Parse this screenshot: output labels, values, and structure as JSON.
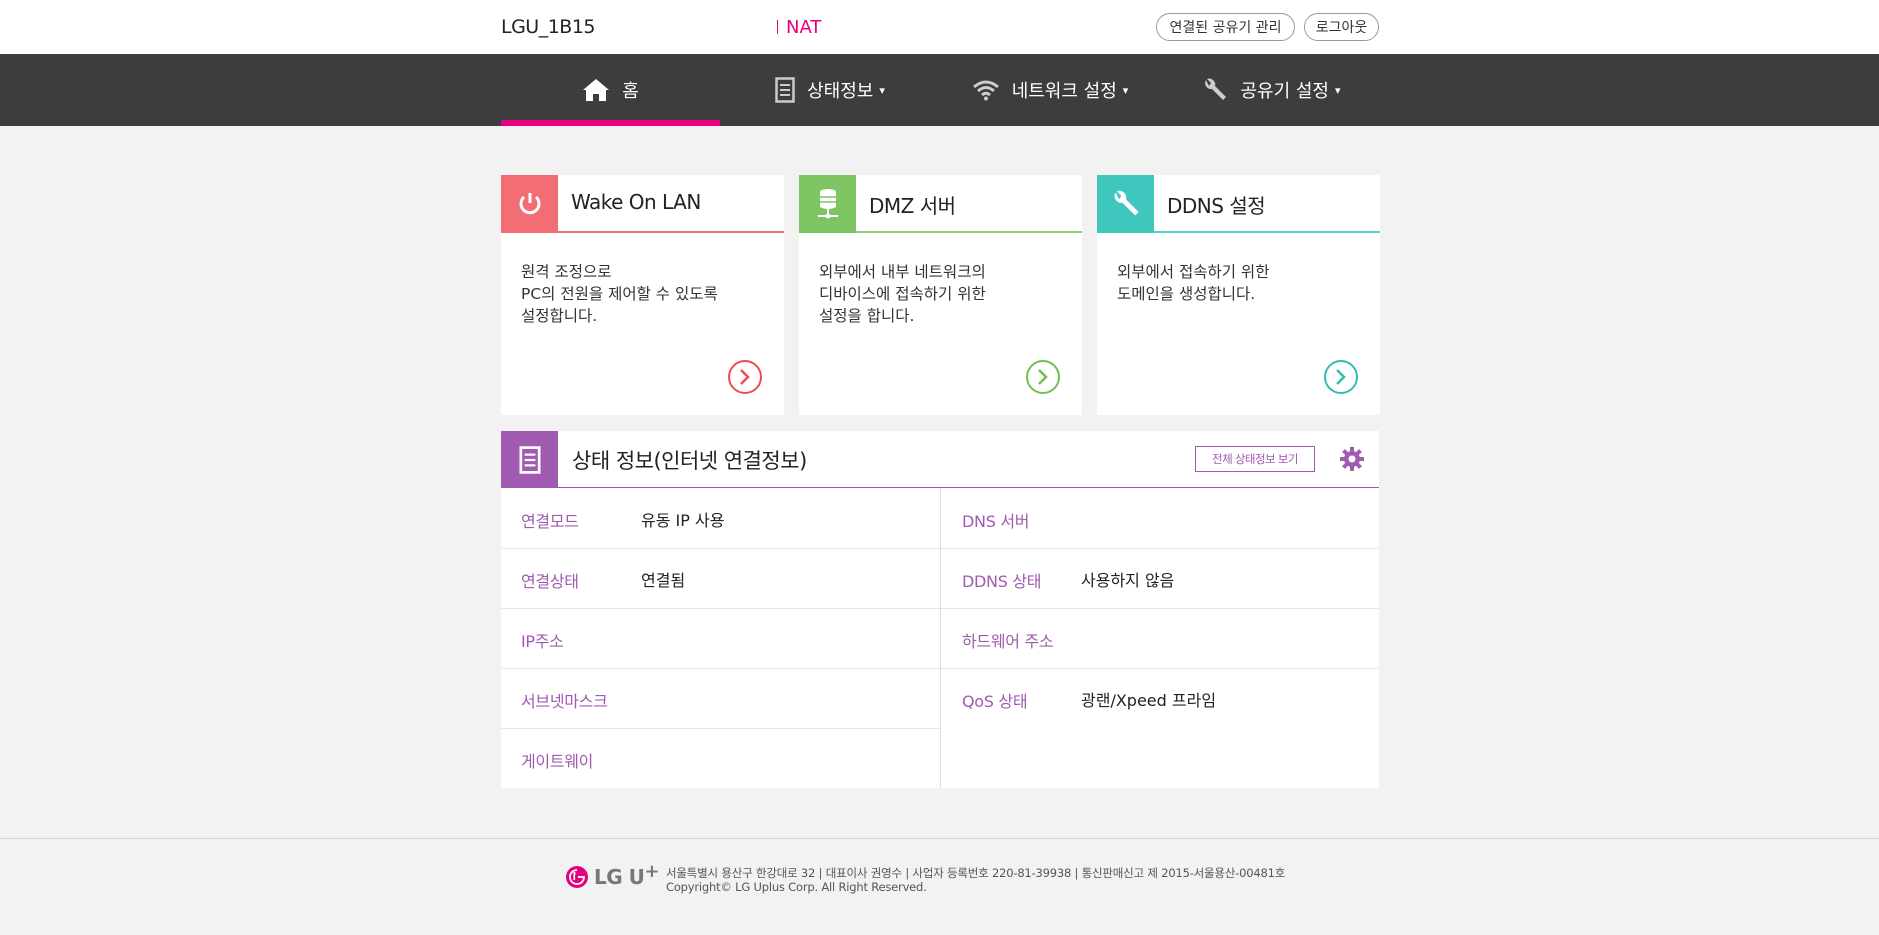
{
  "header": {
    "model": "LGU_1B15",
    "mode": "NAT",
    "manage_button": "연결된 공유기 관리",
    "logout_button": "로그아웃"
  },
  "nav": {
    "home": "홈",
    "status": "상태정보",
    "network": "네트워크 설정",
    "router": "공유기 설정",
    "caret": "▾"
  },
  "cards": [
    {
      "title": "Wake On LAN",
      "desc": [
        "원격 조정으로",
        "PC의 전원을 제어할 수 있도록",
        "설정합니다."
      ],
      "color": "#f26e74"
    },
    {
      "title": "DMZ 서버",
      "desc": [
        "외부에서 내부 네트워크의",
        "디바이스에 접속하기 위한",
        "설정을 합니다."
      ],
      "color": "#7dc462"
    },
    {
      "title": "DDNS 설정",
      "desc": [
        "외부에서 접속하기 위한",
        "도메인을 생성합니다."
      ],
      "color": "#3fc7bd"
    }
  ],
  "status": {
    "title": "상태 정보(인터넷 연결정보)",
    "view_all_button": "전체 상태정보 보기",
    "left": [
      {
        "label": "연결모드",
        "value": "유동 IP 사용"
      },
      {
        "label": "연결상태",
        "value": "연결됨"
      },
      {
        "label": "IP주소",
        "value": ""
      },
      {
        "label": "서브넷마스크",
        "value": ""
      },
      {
        "label": "게이트웨이",
        "value": ""
      }
    ],
    "right": [
      {
        "label": "DNS 서버",
        "value": ""
      },
      {
        "label": "DDNS 상태",
        "value": "사용하지 않음"
      },
      {
        "label": "하드웨어 주소",
        "value": ""
      },
      {
        "label": "QoS 상태",
        "value": "광랜/Xpeed 프라임"
      }
    ]
  },
  "footer": {
    "logo_text": "LG U",
    "logo_plus": "+",
    "line1": "서울특별시 용산구 한강대로 32 |  대표이사 권영수 |  사업자 등록번호 220-81-39938 |  통신판매신고 제 2015-서울용산-00481호",
    "line2": "Copyright© LG Uplus Corp.  All Right Reserved."
  },
  "colors": {
    "accent": "#e6007e",
    "nav_bg": "#3d3d3d",
    "status_purple": "#a05bb0"
  }
}
